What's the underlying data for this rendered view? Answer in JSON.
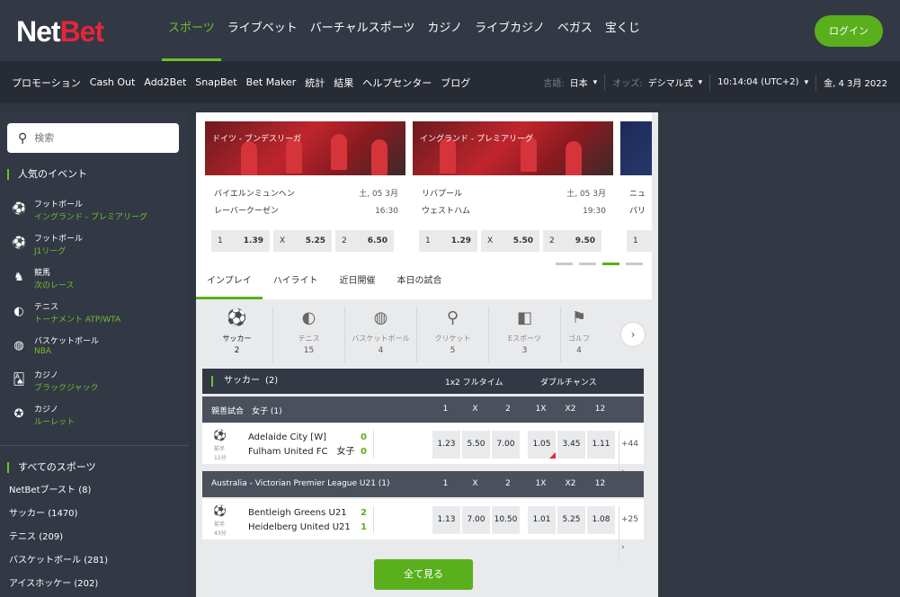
{
  "header": {
    "logo_net": "Net",
    "logo_bet": "Bet",
    "nav": [
      "スポーツ",
      "ライブベット",
      "バーチャルスポーツ",
      "カジノ",
      "ライブカジノ",
      "ベガス",
      "宝くじ"
    ],
    "login": "ログイン"
  },
  "subbar": {
    "links": [
      "プロモーション",
      "Cash Out",
      "Add2Bet",
      "SnapBet",
      "Bet Maker",
      "統計",
      "結果",
      "ヘルプセンター",
      "ブログ"
    ],
    "language_label": "言語:",
    "language_value": "日本",
    "odds_label": "オッズ:",
    "odds_value": "デシマル式",
    "time": "10:14:04  (UTC+2)",
    "date": "金, 4 3月 2022"
  },
  "sidebar": {
    "search_placeholder": "検索",
    "popular_title": "人気のイベント",
    "popular": [
      {
        "icon": "soccer-ball-icon",
        "glyph": "⚽",
        "name": "フットボール",
        "sub": "イングランド - プレミアリーグ"
      },
      {
        "icon": "soccer-ball-icon",
        "glyph": "⚽",
        "name": "フットボール",
        "sub": "J1リーグ"
      },
      {
        "icon": "horse-icon",
        "glyph": "♞",
        "name": "競馬",
        "sub": "次のレース"
      },
      {
        "icon": "tennis-ball-icon",
        "glyph": "◐",
        "name": "テニス",
        "sub": "トーナメント ATP/WTA"
      },
      {
        "icon": "basketball-icon",
        "glyph": "◍",
        "name": "バスケットボール",
        "sub": "NBA"
      },
      {
        "icon": "cards-icon",
        "glyph": "🂡",
        "name": "カジノ",
        "sub": "ブラックジャック"
      },
      {
        "icon": "roulette-icon",
        "glyph": "✪",
        "name": "カジノ",
        "sub": "ルーレット"
      }
    ],
    "all_title": "すべてのスポーツ",
    "all": [
      {
        "name": "NetBetブースト",
        "count": "(8)"
      },
      {
        "name": "サッカー",
        "count": "(1470)"
      },
      {
        "name": "テニス",
        "count": "(209)"
      },
      {
        "name": "バスケットボール",
        "count": "(281)"
      },
      {
        "name": "アイスホッケー",
        "count": "(202)"
      }
    ]
  },
  "carousel": {
    "cards": [
      {
        "league": "ドイツ - ブンデスリーガ",
        "home": "バイエルンミュンヘン",
        "away": "レーバークーゼン",
        "date": "土, 05 3月",
        "time": "16:30",
        "odds": [
          {
            "k": "1",
            "v": "1.39"
          },
          {
            "k": "X",
            "v": "5.25"
          },
          {
            "k": "2",
            "v": "6.50"
          }
        ]
      },
      {
        "league": "イングランド - プレミアリーグ",
        "home": "リバプール",
        "away": "ウェストハム",
        "date": "土, 05 3月",
        "time": "19:30",
        "odds": [
          {
            "k": "1",
            "v": "1.29"
          },
          {
            "k": "X",
            "v": "5.50"
          },
          {
            "k": "2",
            "v": "9.50"
          }
        ]
      },
      {
        "league": "",
        "home": "ニュ",
        "away": "パリ",
        "date": "",
        "time": "",
        "odds": [
          {
            "k": "1",
            "v": ""
          }
        ]
      }
    ],
    "active_dot": 2
  },
  "tabs": [
    "インプレイ",
    "ハイライト",
    "近日開催",
    "本日の試合"
  ],
  "sports": [
    {
      "icon": "soccer-ball-icon",
      "glyph": "⚽",
      "name": "サッカー",
      "count": "2"
    },
    {
      "icon": "tennis-ball-icon",
      "glyph": "◐",
      "name": "テニス",
      "count": "15"
    },
    {
      "icon": "basketball-icon",
      "glyph": "◍",
      "name": "バスケットボール",
      "count": "4"
    },
    {
      "icon": "cricket-icon",
      "glyph": "⚲",
      "name": "クリケット",
      "count": "5"
    },
    {
      "icon": "gamepad-icon",
      "glyph": "◧",
      "name": "Eスポーツ",
      "count": "3"
    },
    {
      "icon": "golf-icon",
      "glyph": "⚑",
      "name": "ゴルフ",
      "count": "4"
    }
  ],
  "section": {
    "title": "サッカー",
    "count": "(2)",
    "col1": "1x2 フルタイム",
    "col2": "ダブルチャンス"
  },
  "leagues": [
    {
      "name": "親善試合　女子 (1)",
      "cols": [
        "1",
        "X",
        "2",
        "1X",
        "X2",
        "12"
      ],
      "match": {
        "status1": "前半",
        "status2": "11分",
        "home": "Adelaide City [W]",
        "away": "Fulham United FC　女子",
        "score_home": "0",
        "score_away": "0",
        "odds": [
          "1.23",
          "5.50",
          "7.00",
          "1.05",
          "3.45",
          "1.11"
        ],
        "more": "+44 ›"
      }
    },
    {
      "name": "Australia - Victorian Premier League U21 (1)",
      "cols": [
        "1",
        "X",
        "2",
        "1X",
        "X2",
        "12"
      ],
      "match": {
        "status1": "前半",
        "status2": "43分",
        "home": "Bentleigh Greens U21",
        "away": "Heidelberg United U21",
        "score_home": "2",
        "score_away": "1",
        "odds": [
          "1.13",
          "7.00",
          "10.50",
          "1.01",
          "5.25",
          "1.08"
        ],
        "more": "+25 ›"
      }
    }
  ],
  "see_all": "全て見る",
  "colors": {
    "brand_green": "#59b01c",
    "accent_red": "#e4263a",
    "header_bg": "#333845"
  }
}
